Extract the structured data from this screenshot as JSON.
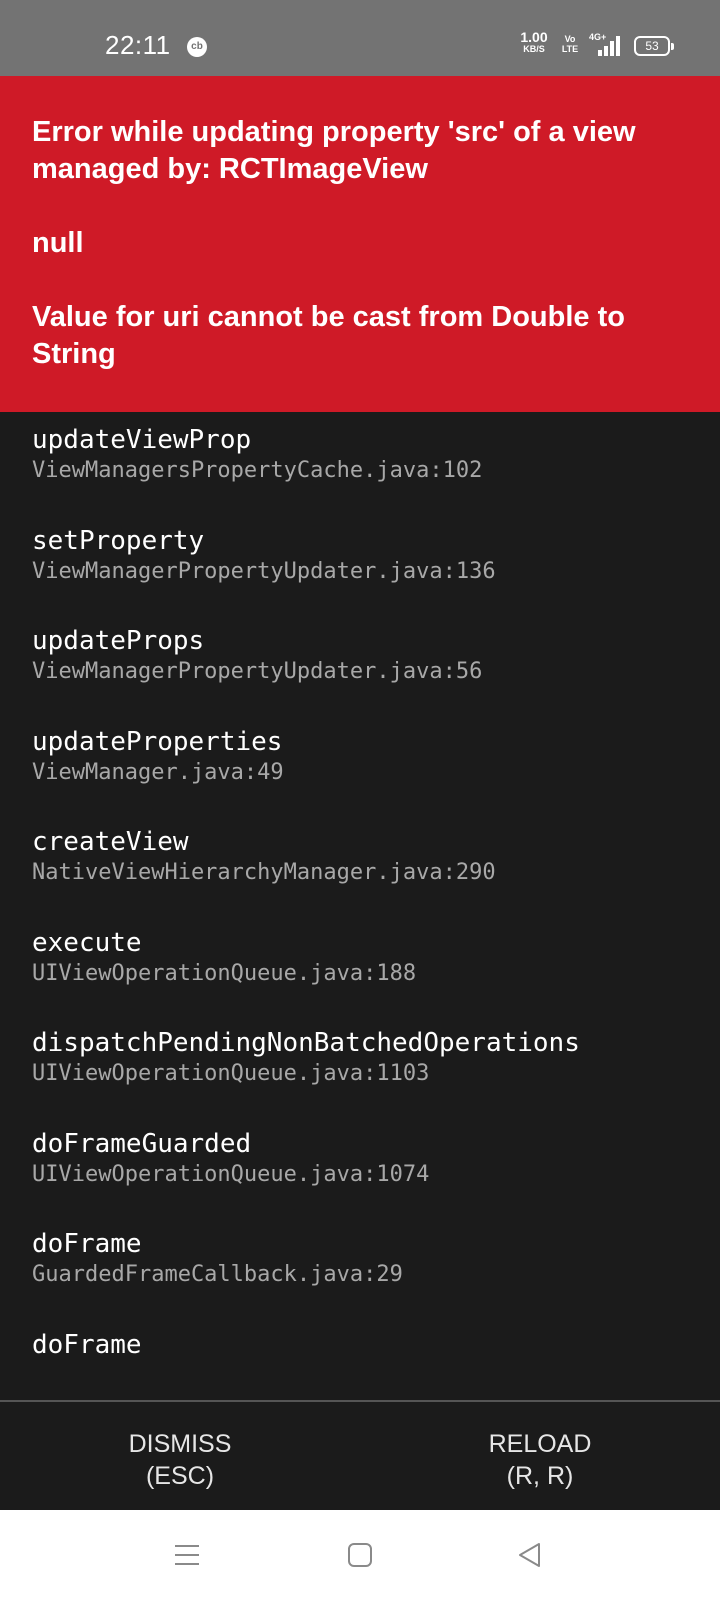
{
  "status_bar": {
    "time": "22:11",
    "notification_icon": "cb",
    "net_speed_value": "1.00",
    "net_speed_unit": "KB/S",
    "volte_top": "Vo",
    "volte_bottom": "LTE",
    "network_type": "4G+",
    "battery": "53",
    "icons": [
      "cb-notification-icon",
      "volte-icon",
      "signal-icon",
      "battery-icon"
    ]
  },
  "error": {
    "title": "Error while updating property 'src' of a view managed by: RCTImageView",
    "detail": "null",
    "message": "Value for uri cannot be cast from Double to String",
    "background_color": "#cf1a27"
  },
  "stack_trace": [
    {
      "method": "updateViewProp",
      "file": "ViewManagersPropertyCache.java:102"
    },
    {
      "method": "setProperty",
      "file": "ViewManagerPropertyUpdater.java:136"
    },
    {
      "method": "updateProps",
      "file": "ViewManagerPropertyUpdater.java:56"
    },
    {
      "method": "updateProperties",
      "file": "ViewManager.java:49"
    },
    {
      "method": "createView",
      "file": "NativeViewHierarchyManager.java:290"
    },
    {
      "method": "execute",
      "file": "UIViewOperationQueue.java:188"
    },
    {
      "method": "dispatchPendingNonBatchedOperations",
      "file": "UIViewOperationQueue.java:1103"
    },
    {
      "method": "doFrameGuarded",
      "file": "UIViewOperationQueue.java:1074"
    },
    {
      "method": "doFrame",
      "file": "GuardedFrameCallback.java:29"
    },
    {
      "method": "doFrame",
      "file": ""
    }
  ],
  "actions": {
    "dismiss_label": "DISMISS",
    "dismiss_hint": "(ESC)",
    "reload_label": "RELOAD",
    "reload_hint": "(R, R)"
  },
  "nav_bar": {
    "icons": [
      "menu-icon",
      "home-icon",
      "back-icon"
    ]
  }
}
